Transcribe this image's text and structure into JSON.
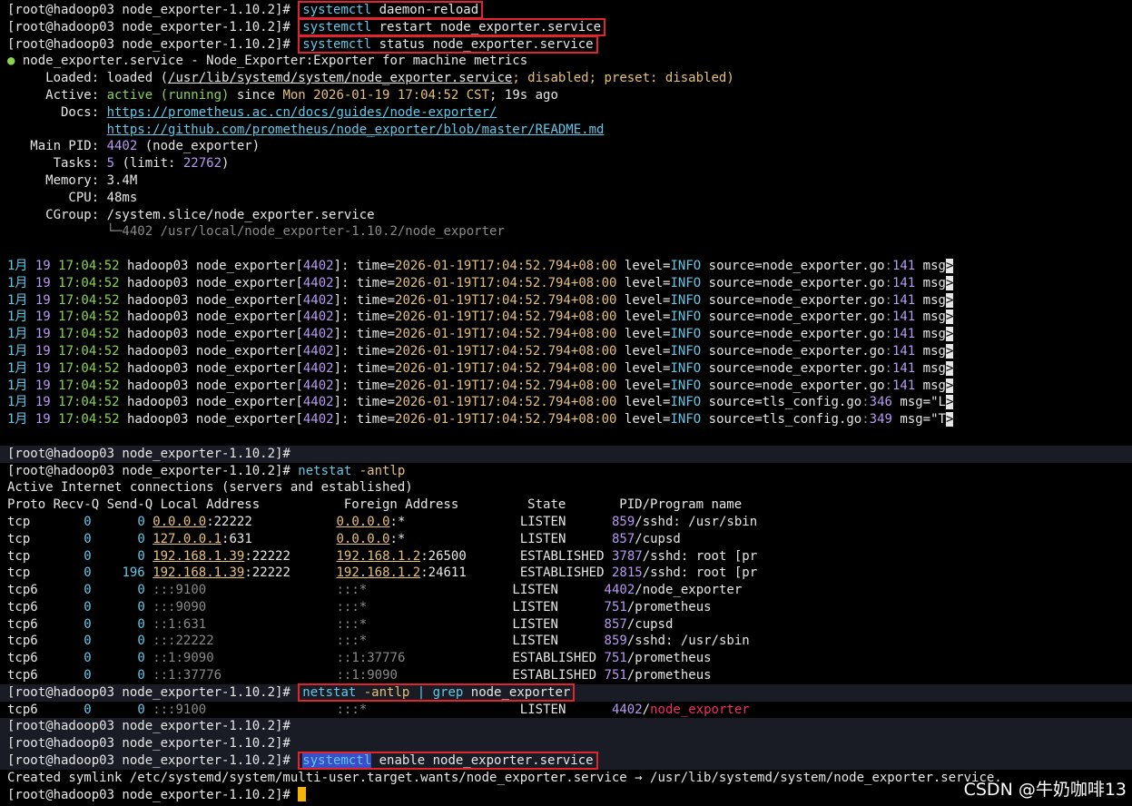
{
  "prompt": "[root@hadoop03 node_exporter-1.10.2]# ",
  "commands": {
    "c1_a": "systemctl",
    "c1_b": " daemon-reload",
    "c2_a": "systemctl",
    "c2_b": " restart node_exporter.service",
    "c3_a": "systemctl",
    "c3_b": " status node_exporter.service",
    "c4_a": "netstat",
    "c4_b": " -antlp",
    "c5_a": "netstat",
    "c5_b": " -antlp",
    "c5_c": " | ",
    "c5_d": "grep",
    "c5_e": " node_exporter",
    "c6_a": "systemctl",
    "c6_b": " enable node_exporter.service"
  },
  "status": {
    "bullet": "●",
    "unit": " node_exporter.service - Node_Exporter:Exporter for machine metrics",
    "loaded_label": "     Loaded: ",
    "loaded_a": "loaded (",
    "loaded_path": "/usr/lib/systemd/system/node_exporter.service",
    "loaded_b": "; disabled; preset: disabled)",
    "active_label": "     Active: ",
    "active_state": "active (running)",
    "active_since": " since ",
    "active_time": "Mon 2026-01-19 17:04:52 CST",
    "active_ago": "; 19s ago",
    "docs_label": "       Docs: ",
    "docs_1": "https://prometheus.ac.cn/docs/guides/node-exporter/",
    "docs_indent": "             ",
    "docs_2": "https://github.com/prometheus/node_exporter/blob/master/README.md",
    "mainpid_label": "   Main PID: ",
    "mainpid": "4402",
    "mainpid_name": " (node_exporter)",
    "tasks_label": "      Tasks: ",
    "tasks": "5",
    "tasks_limit_a": " (limit: ",
    "tasks_limit": "22762",
    "tasks_limit_b": ")",
    "memory_label": "     Memory: ",
    "memory": "3.4M",
    "cpu_label": "        CPU: ",
    "cpu": "48ms",
    "cgroup_label": "     CGroup: ",
    "cgroup": "/system.slice/node_exporter.service",
    "cgroup_child_indent": "             ",
    "cgroup_child": "└─4402 /usr/local/node_exporter-1.10.2/node_exporter"
  },
  "log_lines": [
    {
      "date": "1月 ",
      "day": "19",
      "time": " 17:04:52",
      "host": " hadoop03 node_exporter[",
      "pid": "4402",
      "rest": "]: ",
      "k1": "time=",
      "v1": "2026-01-19T17:04:52.794+08:00",
      "k2": " level=",
      "v2": "INFO",
      "k3": " source=",
      "file": "node_exporter.go",
      "colon": ":",
      "line": "141",
      "msg": " msg",
      "end": ">"
    },
    {
      "date": "1月 ",
      "day": "19",
      "time": " 17:04:52",
      "host": " hadoop03 node_exporter[",
      "pid": "4402",
      "rest": "]: ",
      "k1": "time=",
      "v1": "2026-01-19T17:04:52.794+08:00",
      "k2": " level=",
      "v2": "INFO",
      "k3": " source=",
      "file": "node_exporter.go",
      "colon": ":",
      "line": "141",
      "msg": " msg",
      "end": ">"
    },
    {
      "date": "1月 ",
      "day": "19",
      "time": " 17:04:52",
      "host": " hadoop03 node_exporter[",
      "pid": "4402",
      "rest": "]: ",
      "k1": "time=",
      "v1": "2026-01-19T17:04:52.794+08:00",
      "k2": " level=",
      "v2": "INFO",
      "k3": " source=",
      "file": "node_exporter.go",
      "colon": ":",
      "line": "141",
      "msg": " msg",
      "end": ">"
    },
    {
      "date": "1月 ",
      "day": "19",
      "time": " 17:04:52",
      "host": " hadoop03 node_exporter[",
      "pid": "4402",
      "rest": "]: ",
      "k1": "time=",
      "v1": "2026-01-19T17:04:52.794+08:00",
      "k2": " level=",
      "v2": "INFO",
      "k3": " source=",
      "file": "node_exporter.go",
      "colon": ":",
      "line": "141",
      "msg": " msg",
      "end": ">"
    },
    {
      "date": "1月 ",
      "day": "19",
      "time": " 17:04:52",
      "host": " hadoop03 node_exporter[",
      "pid": "4402",
      "rest": "]: ",
      "k1": "time=",
      "v1": "2026-01-19T17:04:52.794+08:00",
      "k2": " level=",
      "v2": "INFO",
      "k3": " source=",
      "file": "node_exporter.go",
      "colon": ":",
      "line": "141",
      "msg": " msg",
      "end": ">"
    },
    {
      "date": "1月 ",
      "day": "19",
      "time": " 17:04:52",
      "host": " hadoop03 node_exporter[",
      "pid": "4402",
      "rest": "]: ",
      "k1": "time=",
      "v1": "2026-01-19T17:04:52.794+08:00",
      "k2": " level=",
      "v2": "INFO",
      "k3": " source=",
      "file": "node_exporter.go",
      "colon": ":",
      "line": "141",
      "msg": " msg",
      "end": ">"
    },
    {
      "date": "1月 ",
      "day": "19",
      "time": " 17:04:52",
      "host": " hadoop03 node_exporter[",
      "pid": "4402",
      "rest": "]: ",
      "k1": "time=",
      "v1": "2026-01-19T17:04:52.794+08:00",
      "k2": " level=",
      "v2": "INFO",
      "k3": " source=",
      "file": "node_exporter.go",
      "colon": ":",
      "line": "141",
      "msg": " msg",
      "end": ">"
    },
    {
      "date": "1月 ",
      "day": "19",
      "time": " 17:04:52",
      "host": " hadoop03 node_exporter[",
      "pid": "4402",
      "rest": "]: ",
      "k1": "time=",
      "v1": "2026-01-19T17:04:52.794+08:00",
      "k2": " level=",
      "v2": "INFO",
      "k3": " source=",
      "file": "node_exporter.go",
      "colon": ":",
      "line": "141",
      "msg": " msg",
      "end": ">"
    },
    {
      "date": "1月 ",
      "day": "19",
      "time": " 17:04:52",
      "host": " hadoop03 node_exporter[",
      "pid": "4402",
      "rest": "]: ",
      "k1": "time=",
      "v1": "2026-01-19T17:04:52.794+08:00",
      "k2": " level=",
      "v2": "INFO",
      "k3": " source=",
      "file": "tls_config.go",
      "colon": ":",
      "line": "346",
      "msg": " msg=\"L",
      "end": ">"
    },
    {
      "date": "1月 ",
      "day": "19",
      "time": " 17:04:52",
      "host": " hadoop03 node_exporter[",
      "pid": "4402",
      "rest": "]: ",
      "k1": "time=",
      "v1": "2026-01-19T17:04:52.794+08:00",
      "k2": " level=",
      "v2": "INFO",
      "k3": " source=",
      "file": "tls_config.go",
      "colon": ":",
      "line": "349",
      "msg": " msg=\"T",
      "end": ">"
    }
  ],
  "netstat": {
    "title": "Active Internet connections (servers and established)",
    "header": "Proto Recv-Q Send-Q Local Address           Foreign Address         State       PID/Program name",
    "rows": [
      {
        "proto": "tcp       ",
        "recv": "0",
        "sp1": "      ",
        "send": "0",
        "sp2": " ",
        "local_ip": "0.0.0.0",
        "local_port": ":22222",
        "pad1": "           ",
        "for_ip": "0.0.0.0",
        "for_port": ":*",
        "pad2": "               ",
        "state": "LISTEN      ",
        "pid": "859",
        "prog": "/sshd: /usr/sbin",
        "local_u": true,
        "for_u": true
      },
      {
        "proto": "tcp       ",
        "recv": "0",
        "sp1": "      ",
        "send": "0",
        "sp2": " ",
        "local_ip": "127.0.0.1",
        "local_port": ":631",
        "pad1": "           ",
        "for_ip": "0.0.0.0",
        "for_port": ":*",
        "pad2": "               ",
        "state": "LISTEN      ",
        "pid": "857",
        "prog": "/cupsd",
        "local_u": true,
        "for_u": true
      },
      {
        "proto": "tcp       ",
        "recv": "0",
        "sp1": "      ",
        "send": "0",
        "sp2": " ",
        "local_ip": "192.168.1.39",
        "local_port": ":22222",
        "pad1": "      ",
        "for_ip": "192.168.1.2",
        "for_port": ":26500",
        "pad2": "       ",
        "state": "ESTABLISHED ",
        "pid": "3787",
        "prog": "/sshd: root [pr",
        "local_u": true,
        "for_u": true
      },
      {
        "proto": "tcp       ",
        "recv": "0",
        "sp1": "    ",
        "send": "196",
        "sp2": " ",
        "local_ip": "192.168.1.39",
        "local_port": ":22222",
        "pad1": "      ",
        "for_ip": "192.168.1.2",
        "for_port": ":24611",
        "pad2": "       ",
        "state": "ESTABLISHED ",
        "pid": "2815",
        "prog": "/sshd: root [pr",
        "local_u": true,
        "for_u": true
      },
      {
        "proto": "tcp6      ",
        "recv": "0",
        "sp1": "      ",
        "send": "0",
        "sp2": " ",
        "local_ip": ":::",
        "local_port": "9100",
        "pad1": "                 ",
        "for_ip": ":::",
        "for_port": "*",
        "pad2": "                   ",
        "state": "LISTEN      ",
        "pid": "4402",
        "prog": "/node_exporter",
        "local_u": false,
        "for_u": false
      },
      {
        "proto": "tcp6      ",
        "recv": "0",
        "sp1": "      ",
        "send": "0",
        "sp2": " ",
        "local_ip": ":::",
        "local_port": "9090",
        "pad1": "                 ",
        "for_ip": ":::",
        "for_port": "*",
        "pad2": "                   ",
        "state": "LISTEN      ",
        "pid": "751",
        "prog": "/prometheus",
        "local_u": false,
        "for_u": false
      },
      {
        "proto": "tcp6      ",
        "recv": "0",
        "sp1": "      ",
        "send": "0",
        "sp2": " ",
        "local_ip": "::1",
        "local_port": ":631",
        "pad1": "                 ",
        "for_ip": ":::",
        "for_port": "*",
        "pad2": "                   ",
        "state": "LISTEN      ",
        "pid": "857",
        "prog": "/cupsd",
        "local_u": false,
        "for_u": false
      },
      {
        "proto": "tcp6      ",
        "recv": "0",
        "sp1": "      ",
        "send": "0",
        "sp2": " ",
        "local_ip": ":::",
        "local_port": "22222",
        "pad1": "                ",
        "for_ip": ":::",
        "for_port": "*",
        "pad2": "                   ",
        "state": "LISTEN      ",
        "pid": "859",
        "prog": "/sshd: /usr/sbin",
        "local_u": false,
        "for_u": false
      },
      {
        "proto": "tcp6      ",
        "recv": "0",
        "sp1": "      ",
        "send": "0",
        "sp2": " ",
        "local_ip": "::1",
        "local_port": ":9090",
        "pad1": "                ",
        "for_ip": "::1",
        "for_port": ":37776",
        "pad2": "              ",
        "state": "ESTABLISHED ",
        "pid": "751",
        "prog": "/prometheus",
        "local_u": false,
        "for_u": false
      },
      {
        "proto": "tcp6      ",
        "recv": "0",
        "sp1": "      ",
        "send": "0",
        "sp2": " ",
        "local_ip": "::1",
        "local_port": ":37776",
        "pad1": "               ",
        "for_ip": "::1",
        "for_port": ":9090",
        "pad2": "               ",
        "state": "ESTABLISHED ",
        "pid": "751",
        "prog": "/prometheus",
        "local_u": false,
        "for_u": false
      }
    ]
  },
  "grep_row": {
    "proto": "tcp6      ",
    "recv": "0",
    "sp1": "      ",
    "send": "0",
    "sp2": " ",
    "local": ":::9100",
    "pad1": "                 ",
    "foreign": ":::*",
    "pad2": "                    ",
    "state": "LISTEN      ",
    "pid": "4402",
    "slash": "/",
    "prog": "node_exporter"
  },
  "symlink": "Created symlink /etc/systemd/system/multi-user.target.wants/node_exporter.service → /usr/lib/systemd/system/node_exporter.service.",
  "watermark": "CSDN @牛奶咖啡13",
  "colors": {
    "green": "#8bd450",
    "cyan": "#62c8e8",
    "yellow": "#e5c07b",
    "purple": "#b89af2",
    "red": "#f02d6a",
    "box": "#e0262b",
    "cursor": "#f4b400"
  }
}
